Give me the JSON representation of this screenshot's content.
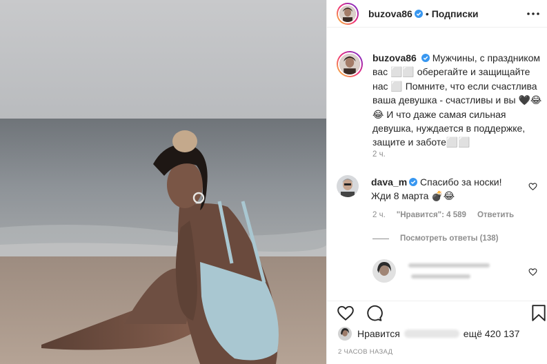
{
  "header": {
    "username": "buzova86",
    "dot": "•",
    "follow_label": "Подписки"
  },
  "caption": {
    "username": "buzova86",
    "text": "Мужчины, с праздником вас ⬜⬜ оберегайте и защищайте нас ⬜ Помните, что если счастлива ваша девушка - счастливы и вы 🖤😂😂 И что даже самая сильная девушка, нуждается в поддержке, защите и заботе⬜⬜",
    "time": "2 ч."
  },
  "comment": {
    "username": "dava_m",
    "text": "Спасибо за носки! Жди 8 марта 💣😂",
    "time": "2 ч.",
    "likes": "\"Нравится\": 4 589",
    "reply_label": "Ответить",
    "view_replies": "Посмотреть ответы (138)"
  },
  "likes": {
    "label": "Нравится",
    "count_text": "ещё 420 137"
  },
  "post_time": "2 ЧАСОВ НАЗАД",
  "icons": {
    "verified": "verified-badge-icon",
    "more": "more-options-icon",
    "like": "heart-icon",
    "comment": "comment-bubble-icon",
    "save": "bookmark-icon"
  },
  "colors": {
    "verified": "#3897f0",
    "text": "#262626",
    "secondary": "#8e8e8e",
    "divider": "#efefef"
  }
}
